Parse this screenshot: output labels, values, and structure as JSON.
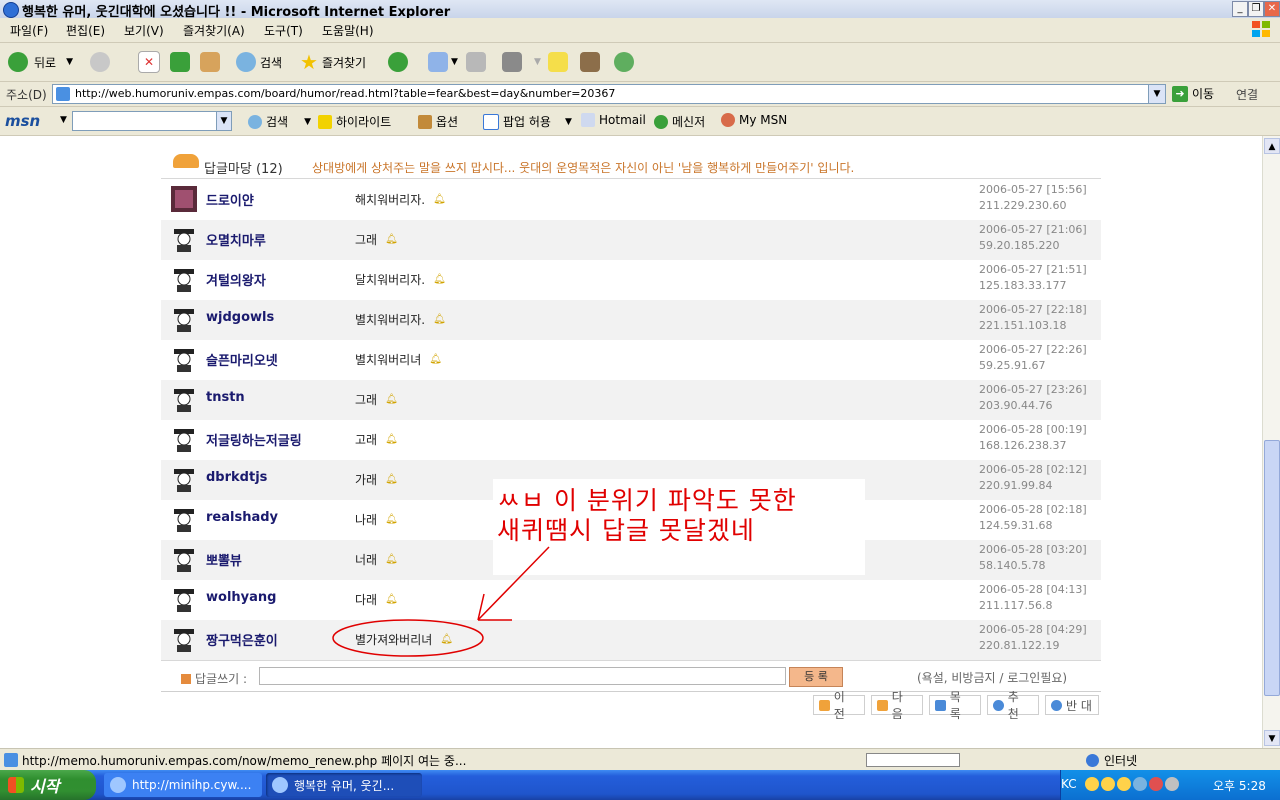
{
  "window": {
    "title": "행복한 유머, 웃긴대학에 오셨습니다 !! - Microsoft Internet Explorer"
  },
  "menu": [
    "파일(F)",
    "편집(E)",
    "보기(V)",
    "즐겨찾기(A)",
    "도구(T)",
    "도움말(H)"
  ],
  "toolbar": {
    "back": "뒤로",
    "search": "검색",
    "favorites": "즐겨찾기"
  },
  "address": {
    "label": "주소(D)",
    "url": "http://web.humoruniv.empas.com/board/humor/read.html?table=fear&best=day&number=20367",
    "go": "이동",
    "links": "연결"
  },
  "msnbar": {
    "logo": "msn",
    "search": "검색",
    "highlight": "하이라이트",
    "options": "옵션",
    "popup": "팝업 허용",
    "hotmail": "Hotmail",
    "messenger": "메신저",
    "mymsn": "My MSN"
  },
  "board": {
    "title": "답글마당 (12)",
    "notice": "상대방에게 상처주는 말을 쓰지 맙시다... 웃대의 운영목적은 자신이 아닌 '남을 행복하게 만들어주기' 입니다.",
    "comments": [
      {
        "name": "드로이얀",
        "text": "해치워버리자.",
        "date": "2006-05-27 [15:56]",
        "ip": "211.229.230.60"
      },
      {
        "name": "오멸치마루",
        "text": "그래",
        "date": "2006-05-27 [21:06]",
        "ip": "59.20.185.220"
      },
      {
        "name": "겨털의왕자",
        "text": "달치워버리자.",
        "date": "2006-05-27 [21:51]",
        "ip": "125.183.33.177"
      },
      {
        "name": "wjdgowls",
        "text": "별치워버리자.",
        "date": "2006-05-27 [22:18]",
        "ip": "221.151.103.18"
      },
      {
        "name": "슬픈마리오넷",
        "text": "별치워버리녀",
        "date": "2006-05-27 [22:26]",
        "ip": "59.25.91.67"
      },
      {
        "name": "tnstn",
        "text": "그래",
        "date": "2006-05-27 [23:26]",
        "ip": "203.90.44.76"
      },
      {
        "name": "저글링하는저글링",
        "text": "고래",
        "date": "2006-05-28 [00:19]",
        "ip": "168.126.238.37"
      },
      {
        "name": "dbrkdtjs",
        "text": "가래",
        "date": "2006-05-28 [02:12]",
        "ip": "220.91.99.84"
      },
      {
        "name": "realshady",
        "text": "나래",
        "date": "2006-05-28 [02:18]",
        "ip": "124.59.31.68"
      },
      {
        "name": "뽀뽈뷰",
        "text": "너래",
        "date": "2006-05-28 [03:20]",
        "ip": "58.140.5.78"
      },
      {
        "name": "wolhyang",
        "text": "다래",
        "date": "2006-05-28 [04:13]",
        "ip": "211.117.56.8"
      },
      {
        "name": "짱구먹은훈이",
        "text": "별가져와버리녀",
        "date": "2006-05-28 [04:29]",
        "ip": "220.81.122.19"
      }
    ],
    "write_label": "답글쓰기 :",
    "submit": "등 록",
    "rules": "(욕설, 비방금지 / 로그인필요)",
    "nav": [
      "이 전",
      "다 음",
      "목 록",
      "추 천",
      "반 대"
    ]
  },
  "annotation": {
    "line1": "ㅆㅂ 이 분위기 파악도 못한",
    "line2": "새퀴땜시 답글 못달겠네"
  },
  "status": {
    "text": "http://memo.humoruniv.empas.com/now/memo_renew.php 페이지 여는 중...",
    "zone": "인터넷"
  },
  "taskbar": {
    "start": "시작",
    "tasks": [
      "http://minihp.cyw....",
      "행복한 유머, 웃긴..."
    ],
    "lang": "KC",
    "clock": "오후 5:28"
  },
  "colors": {
    "notice": "#c9752a",
    "annotation": "#e00000",
    "taskbar": "#245edb",
    "start": "#318f31"
  }
}
